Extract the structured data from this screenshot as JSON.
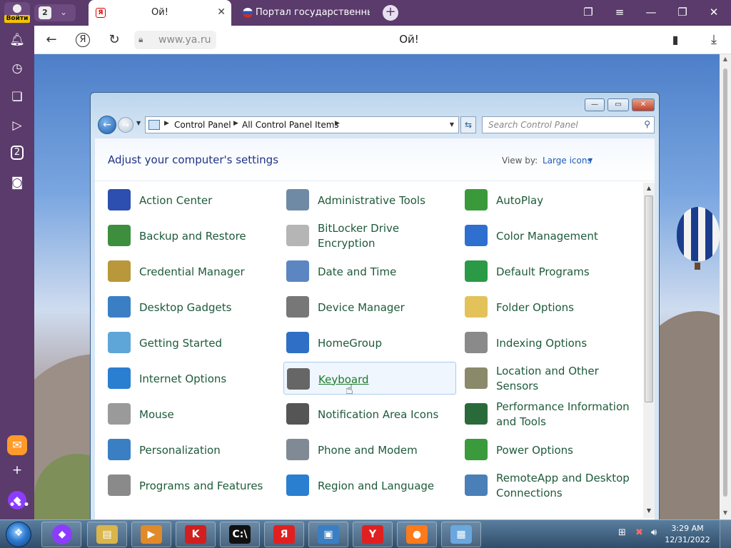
{
  "browser": {
    "login_label": "Войти",
    "tab_count": "2",
    "active_tab_title": "Ой!",
    "inactive_tab_title": "Портал государственных у",
    "url": "www.ya.ru",
    "page_title": "Ой!",
    "sidebar_badge": "2"
  },
  "control_panel": {
    "breadcrumb": [
      "Control Panel",
      "All Control Panel Items"
    ],
    "search_placeholder": "Search Control Panel",
    "heading": "Adjust your computer's settings",
    "view_by_label": "View by:",
    "view_by_value": "Large icons",
    "items": [
      {
        "label": "Action Center",
        "icon": "flag-icon",
        "color": "#2c4fb0"
      },
      {
        "label": "Administrative Tools",
        "icon": "admin-tools-icon",
        "color": "#6f8aa5"
      },
      {
        "label": "AutoPlay",
        "icon": "autoplay-icon",
        "color": "#3a9a3a"
      },
      {
        "label": "Backup and Restore",
        "icon": "backup-icon",
        "color": "#3d8f3d"
      },
      {
        "label": "BitLocker Drive Encryption",
        "icon": "bitlocker-icon",
        "color": "#b5b5b5"
      },
      {
        "label": "Color Management",
        "icon": "color-management-icon",
        "color": "#2e6fd0"
      },
      {
        "label": "Credential Manager",
        "icon": "credential-icon",
        "color": "#b8983a"
      },
      {
        "label": "Date and Time",
        "icon": "calendar-clock-icon",
        "color": "#5b86c2"
      },
      {
        "label": "Default Programs",
        "icon": "default-programs-icon",
        "color": "#2b9a47"
      },
      {
        "label": "Desktop Gadgets",
        "icon": "gadgets-icon",
        "color": "#3a7fc4"
      },
      {
        "label": "Device Manager",
        "icon": "device-manager-icon",
        "color": "#777777"
      },
      {
        "label": "Folder Options",
        "icon": "folder-icon",
        "color": "#e3c25a"
      },
      {
        "label": "Getting Started",
        "icon": "getting-started-icon",
        "color": "#5fa6d8"
      },
      {
        "label": "HomeGroup",
        "icon": "homegroup-icon",
        "color": "#2f6fc6"
      },
      {
        "label": "Indexing Options",
        "icon": "indexing-icon",
        "color": "#8a8a8a"
      },
      {
        "label": "Internet Options",
        "icon": "internet-options-icon",
        "color": "#2a7fd0"
      },
      {
        "label": "Keyboard",
        "icon": "keyboard-icon",
        "color": "#666666"
      },
      {
        "label": "Location and Other Sensors",
        "icon": "sensors-icon",
        "color": "#8a8a6a"
      },
      {
        "label": "Mouse",
        "icon": "mouse-icon",
        "color": "#9a9a9a"
      },
      {
        "label": "Notification Area Icons",
        "icon": "notification-icon",
        "color": "#555555"
      },
      {
        "label": "Performance Information and Tools",
        "icon": "performance-icon",
        "color": "#2a6a3a"
      },
      {
        "label": "Personalization",
        "icon": "personalization-icon",
        "color": "#3a7fc4"
      },
      {
        "label": "Phone and Modem",
        "icon": "phone-icon",
        "color": "#7f8a94"
      },
      {
        "label": "Power Options",
        "icon": "power-icon",
        "color": "#3b9a3b"
      },
      {
        "label": "Programs and Features",
        "icon": "programs-icon",
        "color": "#8a8a8a"
      },
      {
        "label": "Region and Language",
        "icon": "globe-icon",
        "color": "#2a7fd0"
      },
      {
        "label": "RemoteApp and Desktop Connections",
        "icon": "remoteapp-icon",
        "color": "#4a7fb8"
      }
    ],
    "hovered_item": "Keyboard"
  },
  "taskbar": {
    "clock_time": "3:29 AM",
    "clock_date": "12/31/2022",
    "apps": [
      {
        "name": "explorer",
        "glyph": "▤",
        "color": "#d9b54a"
      },
      {
        "name": "media-player",
        "glyph": "▶",
        "color": "#e08a2a"
      },
      {
        "name": "kaspersky",
        "glyph": "K",
        "color": "#d01f1f"
      },
      {
        "name": "cmd",
        "glyph": "C:\\",
        "color": "#111111"
      },
      {
        "name": "yandex",
        "glyph": "Я",
        "color": "#e02020"
      },
      {
        "name": "photo-viewer",
        "glyph": "▣",
        "color": "#3a7fc4"
      },
      {
        "name": "yandex-browser",
        "glyph": "Y",
        "color": "#e02020"
      },
      {
        "name": "firefox",
        "glyph": "●",
        "color": "#ff7a1a"
      },
      {
        "name": "control-panel",
        "glyph": "▦",
        "color": "#6aa7dd"
      }
    ]
  }
}
